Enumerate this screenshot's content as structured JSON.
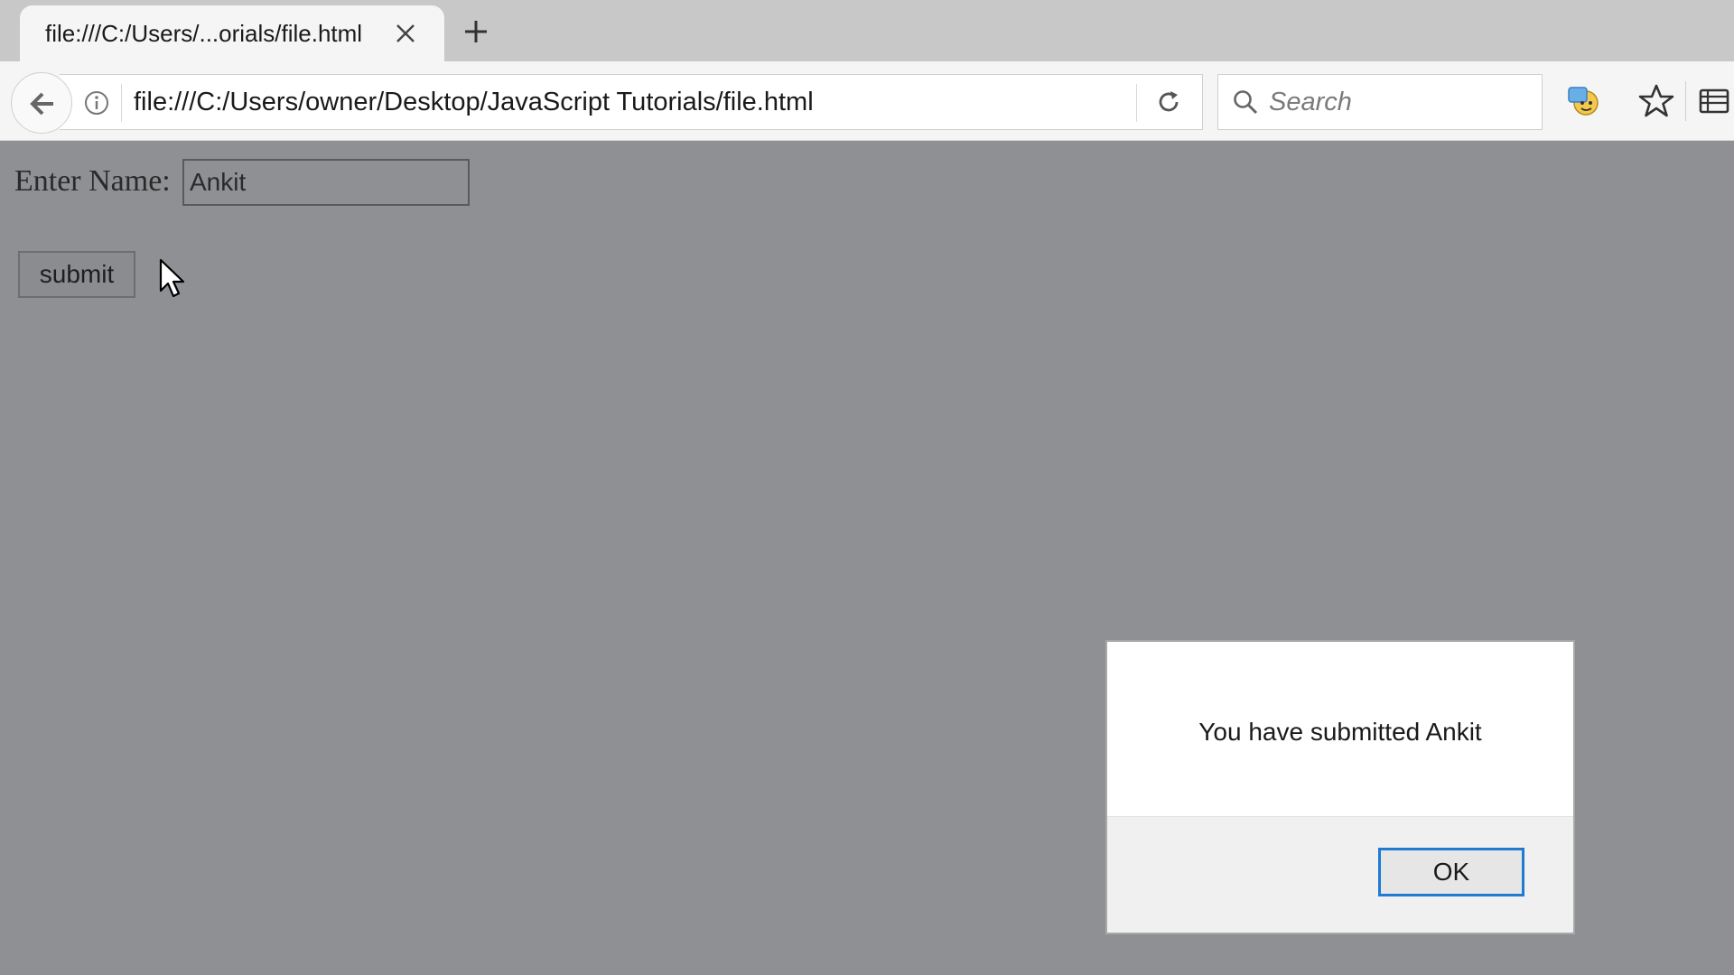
{
  "browser": {
    "tab": {
      "title": "file:///C:/Users/...orials/file.html"
    },
    "address_bar": {
      "url": "file:///C:/Users/owner/Desktop/JavaScript Tutorials/file.html"
    },
    "search": {
      "placeholder": "Search"
    },
    "icons": {
      "tab_close": "close-icon",
      "new_tab": "plus-icon",
      "back": "back-arrow-icon",
      "info": "info-icon",
      "reload": "reload-icon",
      "search": "magnifier-icon",
      "extension": "extension-icon",
      "bookmark": "star-icon",
      "library": "library-icon"
    }
  },
  "page": {
    "name_label": "Enter Name:",
    "name_value": "Ankit",
    "submit_label": "submit",
    "background_color": "#8e9094"
  },
  "alert": {
    "message": "You have submitted Ankit",
    "ok_label": "OK",
    "focus_color": "#1f7ad2"
  }
}
